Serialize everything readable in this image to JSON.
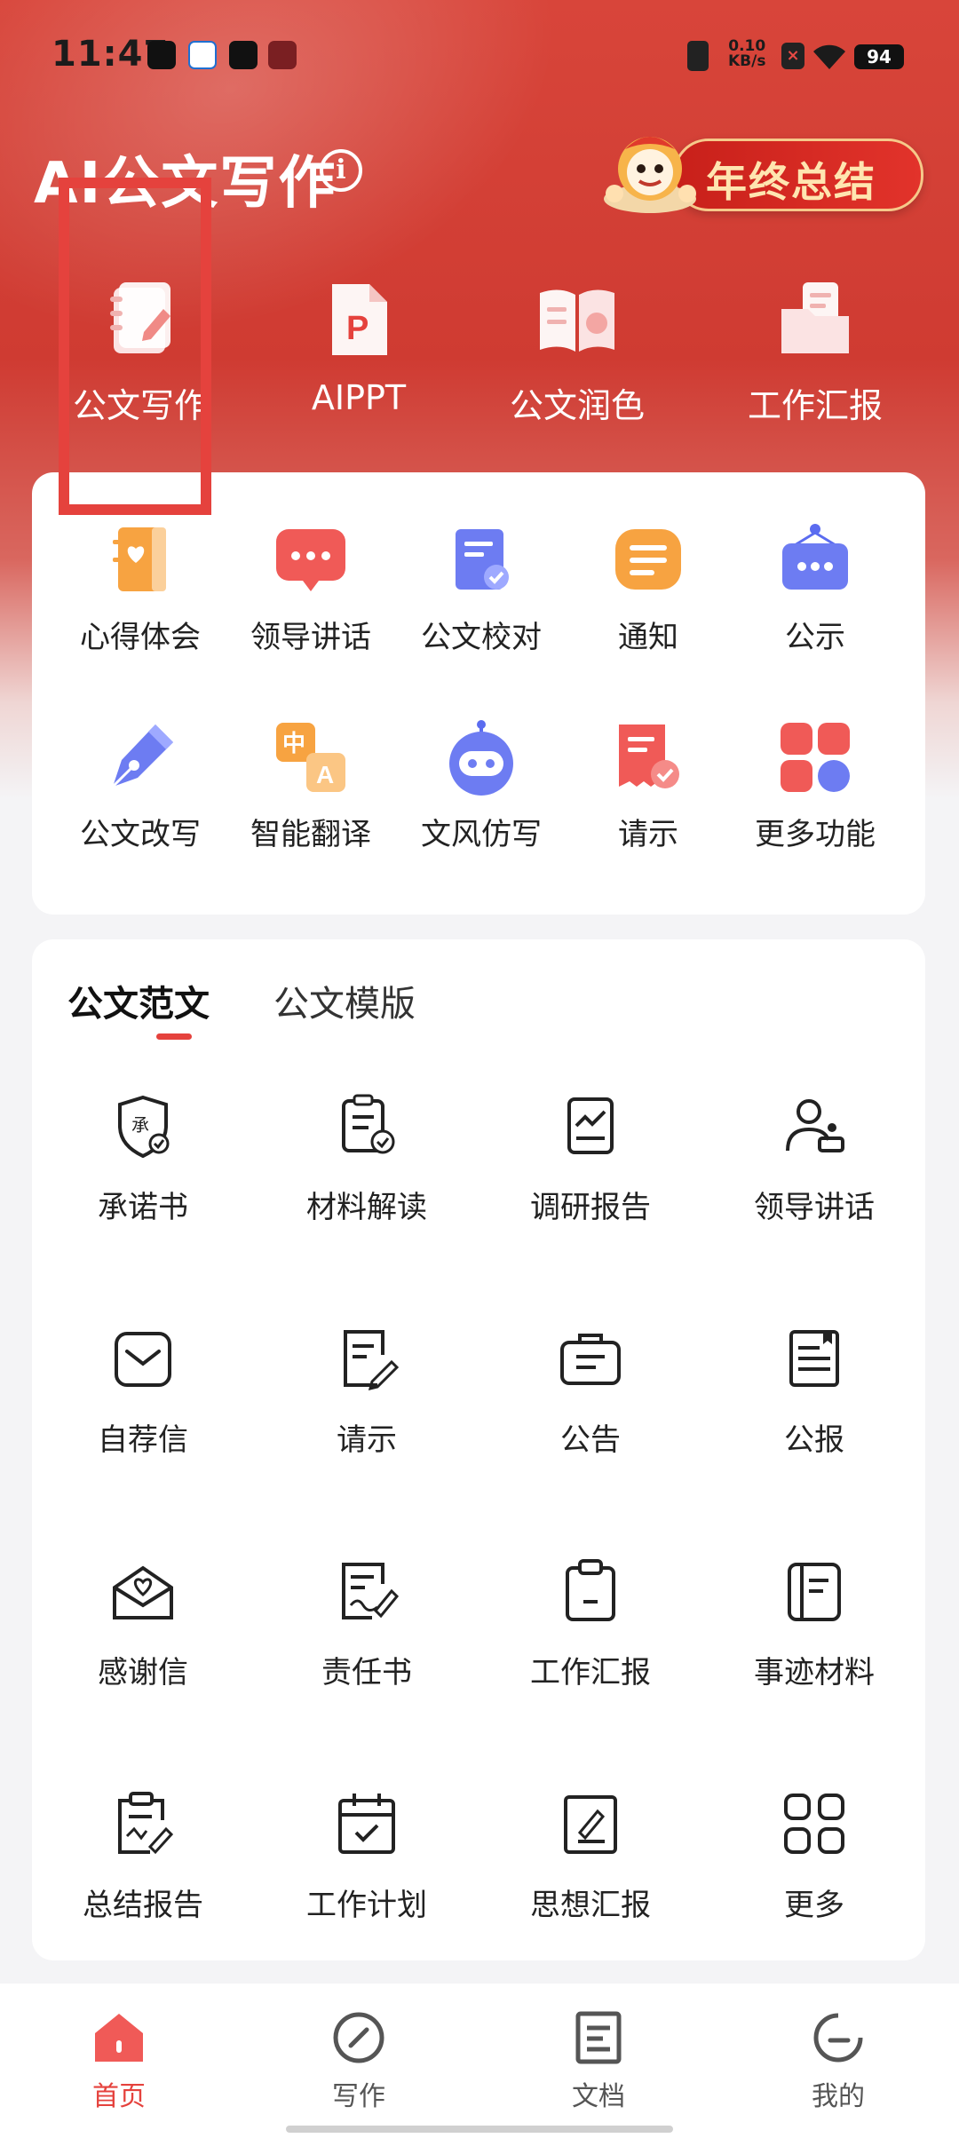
{
  "status_bar": {
    "time": "11:47",
    "net_speed_value": "0.10",
    "net_speed_unit": "KB/s",
    "battery": "94"
  },
  "header": {
    "title": "AI公文写作",
    "banner_text": "年终总结"
  },
  "top_features": [
    {
      "label": "公文写作",
      "icon": "notebook-pen-icon"
    },
    {
      "label": "AIPPT",
      "icon": "ppt-file-icon"
    },
    {
      "label": "公文润色",
      "icon": "open-book-icon"
    },
    {
      "label": "工作汇报",
      "icon": "folder-doc-icon"
    }
  ],
  "tools": [
    {
      "label": "心得体会",
      "icon": "heart-notebook-icon"
    },
    {
      "label": "领导讲话",
      "icon": "chat-bubble-icon"
    },
    {
      "label": "公文校对",
      "icon": "doc-check-icon"
    },
    {
      "label": "通知",
      "icon": "notice-lines-icon"
    },
    {
      "label": "公示",
      "icon": "announcement-board-icon"
    },
    {
      "label": "公文改写",
      "icon": "fountain-pen-icon"
    },
    {
      "label": "智能翻译",
      "icon": "translate-icon"
    },
    {
      "label": "文风仿写",
      "icon": "robot-icon"
    },
    {
      "label": "请示",
      "icon": "receipt-check-icon"
    },
    {
      "label": "更多功能",
      "icon": "grid-apps-icon"
    }
  ],
  "templates": {
    "tabs": [
      {
        "label": "公文范文",
        "active": true
      },
      {
        "label": "公文模版",
        "active": false
      }
    ],
    "items": [
      {
        "label": "承诺书",
        "icon": "promise-shield-icon"
      },
      {
        "label": "材料解读",
        "icon": "material-check-icon"
      },
      {
        "label": "调研报告",
        "icon": "research-chart-icon"
      },
      {
        "label": "领导讲话",
        "icon": "speaker-podium-icon"
      },
      {
        "label": "自荐信",
        "icon": "envelope-icon"
      },
      {
        "label": "请示",
        "icon": "doc-edit-icon"
      },
      {
        "label": "公告",
        "icon": "briefcase-doc-icon"
      },
      {
        "label": "公报",
        "icon": "bulletin-icon"
      },
      {
        "label": "感谢信",
        "icon": "heart-envelope-icon"
      },
      {
        "label": "责任书",
        "icon": "doc-sign-icon"
      },
      {
        "label": "工作汇报",
        "icon": "clipboard-icon"
      },
      {
        "label": "事迹材料",
        "icon": "record-book-icon"
      },
      {
        "label": "总结报告",
        "icon": "summary-clipboard-icon"
      },
      {
        "label": "工作计划",
        "icon": "calendar-check-icon"
      },
      {
        "label": "思想汇报",
        "icon": "thought-doc-icon"
      },
      {
        "label": "更多",
        "icon": "more-grid-icon"
      }
    ]
  },
  "bottom_nav": [
    {
      "label": "首页",
      "icon": "home-icon",
      "active": true
    },
    {
      "label": "写作",
      "icon": "write-circle-icon",
      "active": false
    },
    {
      "label": "文档",
      "icon": "document-icon",
      "active": false
    },
    {
      "label": "我的",
      "icon": "profile-icon",
      "active": false
    }
  ],
  "colors": {
    "brand_red": "#e5423d",
    "header_red": "#d0413a",
    "tab_underline": "#e5423d"
  }
}
